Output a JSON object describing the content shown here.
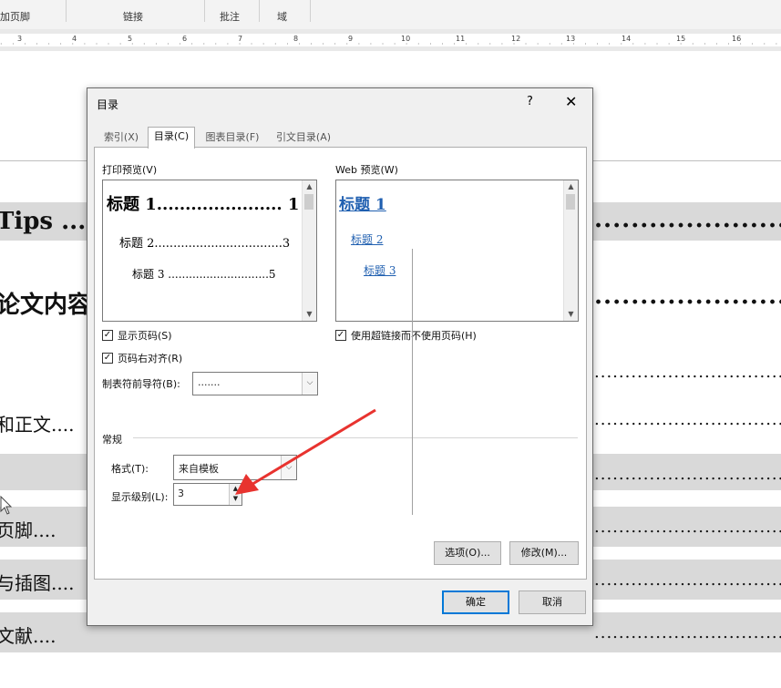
{
  "ribbon": {
    "groups": [
      "加页脚",
      "链接",
      "批注",
      "域"
    ]
  },
  "ruler": {
    "numbers": [
      "3",
      "4",
      "5",
      "6",
      "7",
      "8",
      "9",
      "10",
      "11",
      "12",
      "13",
      "14",
      "15",
      "16"
    ]
  },
  "document": {
    "lines": [
      {
        "text": "Tips ....",
        "right_dots": "....................................",
        "shade": true
      },
      {
        "text": "论文内容",
        "right_dots": "....................................",
        "shade": false
      },
      {
        "text": "",
        "right_dots": "................................................",
        "shade": false
      },
      {
        "text": "和正文....",
        "right_dots": "................................................",
        "shade": false
      },
      {
        "text": "",
        "right_dots": "................................................",
        "shade": true
      },
      {
        "text": "页脚....",
        "right_dots": "................................................",
        "shade": true
      },
      {
        "text": "与插图....",
        "right_dots": "................................................",
        "shade": true
      },
      {
        "text": "文献....",
        "right_dots": "................................................",
        "shade": true
      }
    ]
  },
  "dialog": {
    "title": "目录",
    "help": "?",
    "close": "✕",
    "tabs": [
      {
        "label": "索引(X)"
      },
      {
        "label": "目录(C)"
      },
      {
        "label": "图表目录(F)"
      },
      {
        "label": "引文目录(A)"
      }
    ],
    "print_preview": {
      "label": "打印预览(V)",
      "h1": "标题 1...................... 1",
      "h2": "标题 2..................................3",
      "h3": "标题 3 .............................5"
    },
    "web_preview": {
      "label": "Web 预览(W)",
      "h1": "标题 1",
      "h2": "标题 2",
      "h3": "标题 3"
    },
    "show_page_numbers": {
      "label": "显示页码(S)",
      "checked": true
    },
    "right_align": {
      "label": "页码右对齐(R)",
      "checked": true
    },
    "leader": {
      "label": "制表符前导符(B):",
      "value": "......."
    },
    "use_hyperlinks": {
      "label": "使用超链接而不使用页码(H)",
      "checked": true
    },
    "general": {
      "label": "常规",
      "format_label": "格式(T):",
      "format_value": "来自模板",
      "levels_label": "显示级别(L):",
      "levels_value": "3"
    },
    "buttons": {
      "options": "选项(O)...",
      "modify": "修改(M)...",
      "ok": "确定",
      "cancel": "取消"
    }
  },
  "colors": {
    "accent": "#0078d7",
    "link": "#1f5fb0",
    "annotation_arrow": "#e8332f"
  },
  "icons": {
    "check": "✓",
    "arrow_up": "▲",
    "arrow_down": "▼",
    "combo_down": "⌵"
  }
}
